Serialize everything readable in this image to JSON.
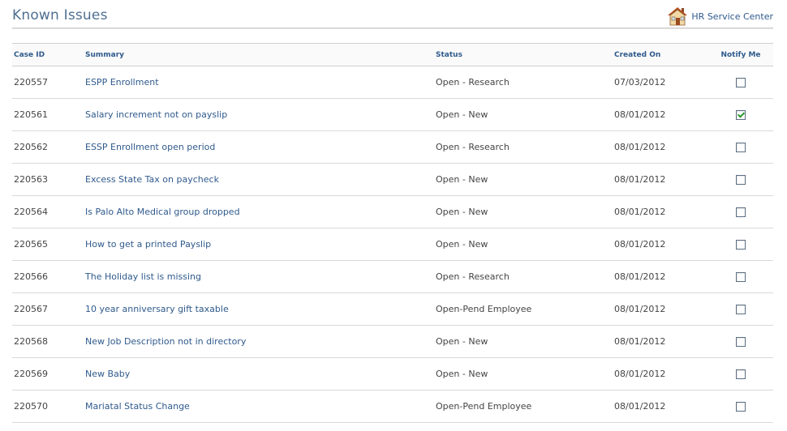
{
  "header": {
    "title": "Known Issues",
    "hr_link_label": "HR Service Center",
    "hr_link_icon": "house-icon"
  },
  "table": {
    "columns": {
      "case_id": "Case ID",
      "summary": "Summary",
      "status": "Status",
      "created_on": "Created On",
      "notify_me": "Notify Me"
    },
    "rows": [
      {
        "case_id": "220557",
        "summary": "ESPP Enrollment",
        "status": "Open - Research",
        "created_on": "07/03/2012",
        "notify": false
      },
      {
        "case_id": "220561",
        "summary": "Salary increment not on payslip",
        "status": "Open - New",
        "created_on": "08/01/2012",
        "notify": true
      },
      {
        "case_id": "220562",
        "summary": "ESSP Enrollment open period",
        "status": "Open - Research",
        "created_on": "08/01/2012",
        "notify": false
      },
      {
        "case_id": "220563",
        "summary": "Excess State Tax on paycheck",
        "status": "Open - New",
        "created_on": "08/01/2012",
        "notify": false
      },
      {
        "case_id": "220564",
        "summary": "Is Palo Alto Medical group dropped",
        "status": "Open - New",
        "created_on": "08/01/2012",
        "notify": false
      },
      {
        "case_id": "220565",
        "summary": "How to get a printed Payslip",
        "status": "Open - New",
        "created_on": "08/01/2012",
        "notify": false
      },
      {
        "case_id": "220566",
        "summary": "The Holiday list is missing",
        "status": "Open - Research",
        "created_on": "08/01/2012",
        "notify": false
      },
      {
        "case_id": "220567",
        "summary": "10 year anniversary gift taxable",
        "status": "Open-Pend Employee",
        "created_on": "08/01/2012",
        "notify": false
      },
      {
        "case_id": "220568",
        "summary": "New Job Description not in directory",
        "status": "Open - New",
        "created_on": "08/01/2012",
        "notify": false
      },
      {
        "case_id": "220569",
        "summary": "New Baby",
        "status": "Open - New",
        "created_on": "08/01/2012",
        "notify": false
      },
      {
        "case_id": "220570",
        "summary": "Mariatal Status Change",
        "status": "Open-Pend Employee",
        "created_on": "08/01/2012",
        "notify": false
      }
    ]
  },
  "colors": {
    "title": "#4f6f92",
    "link": "#2f5a8c",
    "header_text": "#2f5a8c",
    "body_text": "#444444",
    "checkmark": "#2e9a2e"
  }
}
